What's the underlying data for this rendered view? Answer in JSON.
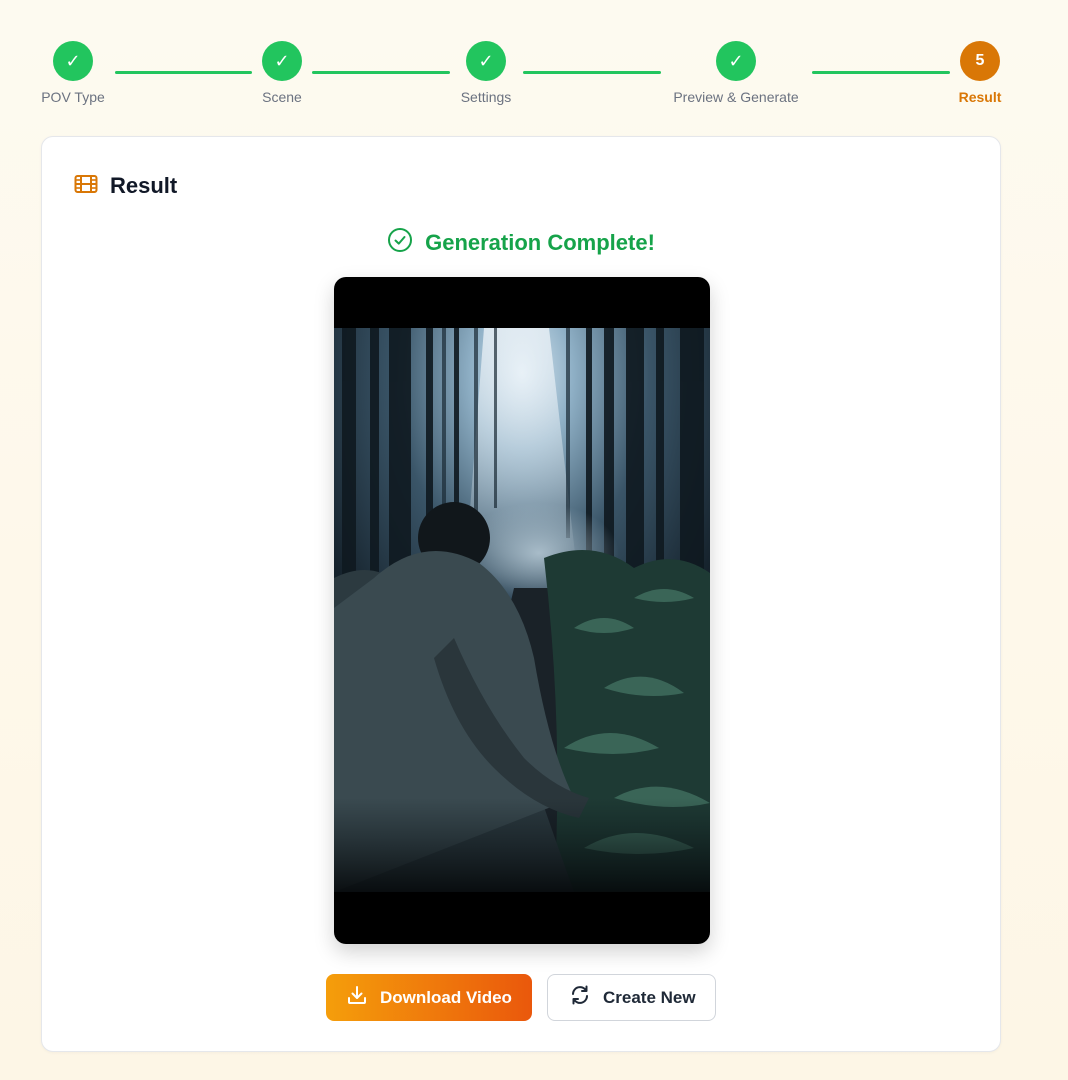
{
  "stepper": {
    "steps": [
      {
        "label": "POV Type",
        "state": "complete",
        "marker": "✓"
      },
      {
        "label": "Scene",
        "state": "complete",
        "marker": "✓"
      },
      {
        "label": "Settings",
        "state": "complete",
        "marker": "✓"
      },
      {
        "label": "Preview & Generate",
        "state": "complete",
        "marker": "✓"
      },
      {
        "label": "Result",
        "state": "active",
        "marker": "5"
      }
    ]
  },
  "card": {
    "title": "Result",
    "title_icon": "film-icon",
    "status_text": "Generation Complete!",
    "status_icon": "check-circle-icon"
  },
  "video": {
    "scene": "forest-trail-person-in-hooded-jacket"
  },
  "actions": {
    "download_label": "Download Video",
    "download_icon": "download-icon",
    "create_new_label": "Create New",
    "create_new_icon": "refresh-icon"
  },
  "colors": {
    "complete": "#22c55e",
    "active": "#d97706",
    "success_text": "#16a34a",
    "primary_gradient_start": "#f59e0b",
    "primary_gradient_end": "#ea580c"
  }
}
